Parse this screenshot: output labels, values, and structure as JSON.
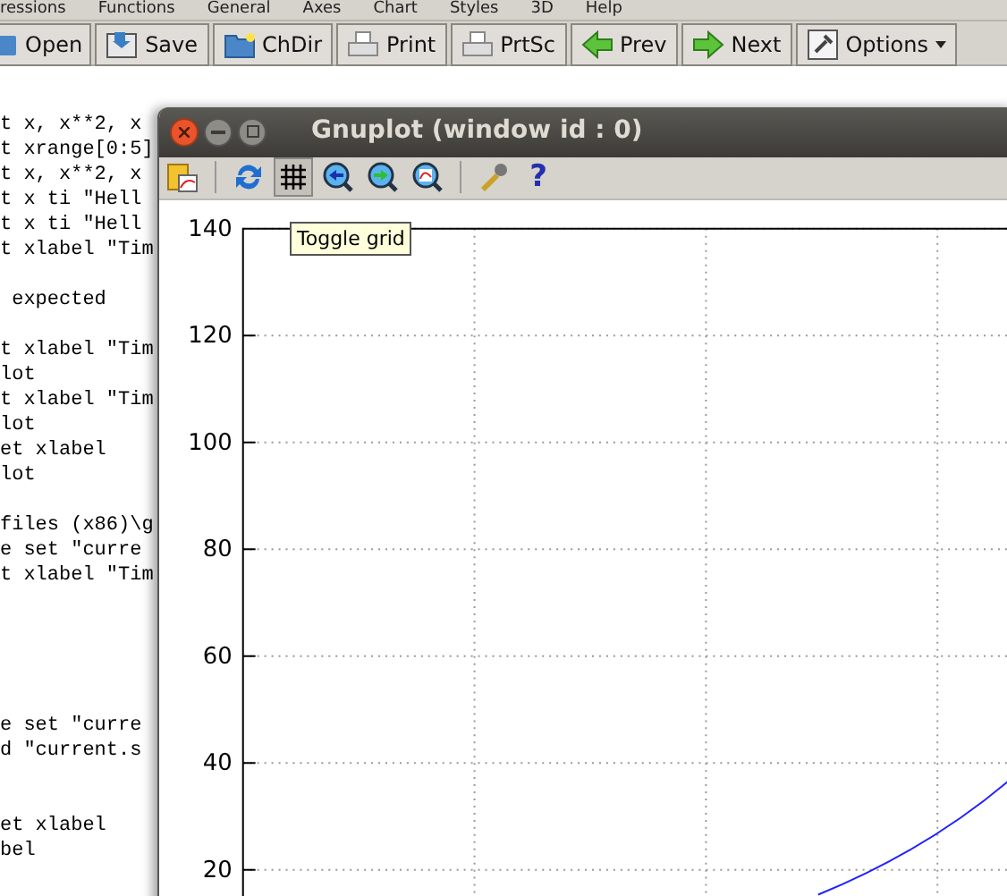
{
  "menu": [
    "ressions",
    "Functions",
    "General",
    "Axes",
    "Chart",
    "Styles",
    "3D",
    "Help"
  ],
  "toolbar": [
    {
      "kind": "open",
      "label": "Open"
    },
    {
      "kind": "save",
      "label": "Save"
    },
    {
      "kind": "folder",
      "label": "ChDir"
    },
    {
      "kind": "print",
      "label": "Print"
    },
    {
      "kind": "print",
      "label": "PrtSc"
    },
    {
      "kind": "prev",
      "label": "Prev"
    },
    {
      "kind": "next",
      "label": "Next"
    },
    {
      "kind": "options",
      "label": "Options"
    }
  ],
  "editor_blocks": [
    [
      "t x, x**2, x",
      "t xrange[0:5]",
      "t x, x**2, x",
      "t x ti \"Hell",
      "t x ti \"Hell",
      "t xlabel \"Tim"
    ],
    [
      " expected"
    ],
    [
      "t xlabel \"Tim",
      "lot",
      "t xlabel \"Tim",
      "lot",
      "et xlabel",
      "lot"
    ],
    [
      "files (x86)\\g",
      "e set \"curre",
      "t xlabel \"Tim"
    ],
    [
      "e set \"curre",
      "d \"current.s"
    ],
    [
      "et xlabel",
      "bel"
    ]
  ],
  "gnuplot_window": {
    "title": "Gnuplot (window id : 0)",
    "tools": [
      {
        "kind": "copy",
        "selected": false
      },
      {
        "kind": "separator"
      },
      {
        "kind": "refresh",
        "selected": false
      },
      {
        "kind": "grid",
        "selected": true
      },
      {
        "kind": "zoom-prev",
        "selected": false
      },
      {
        "kind": "zoom-next",
        "selected": false
      },
      {
        "kind": "zoom-fit",
        "selected": false
      },
      {
        "kind": "separator"
      },
      {
        "kind": "settings",
        "selected": false
      },
      {
        "kind": "help",
        "label": "?",
        "selected": false
      }
    ],
    "tooltip": "Toggle grid",
    "y_tick_labels": [
      "140",
      "120",
      "100",
      "80",
      "60",
      "40",
      "20"
    ]
  }
}
